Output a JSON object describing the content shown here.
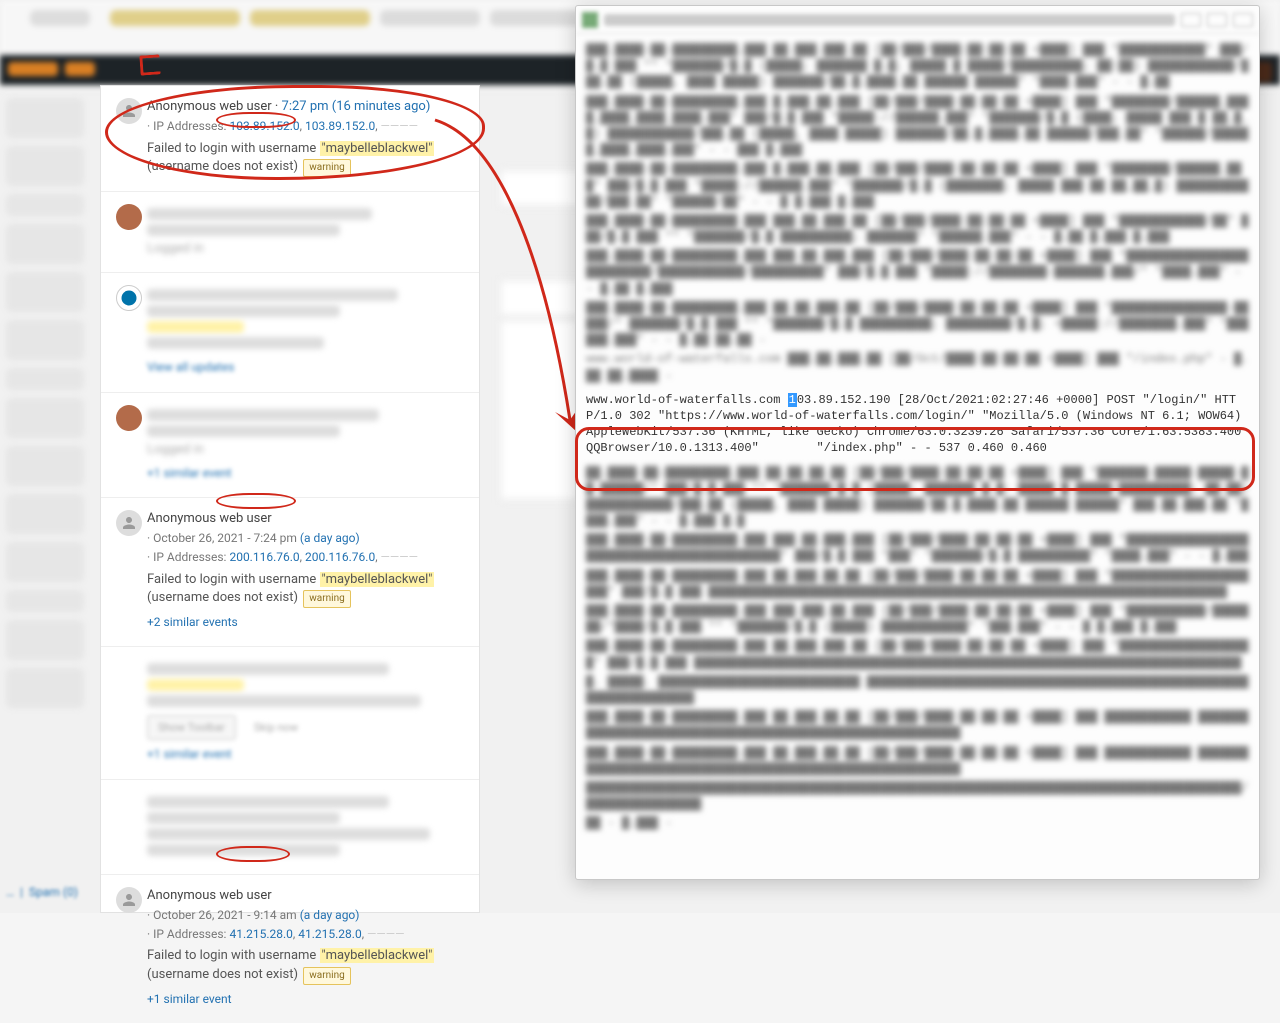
{
  "feed": [
    {
      "user": "Anonymous web user",
      "time": "7:27 pm (16 minutes ago)",
      "ip_label": "IP Addresses:",
      "ip1": "103.89.152.0",
      "ip2": "103.89.152.0",
      "msg_pre": "Failed to login with username ",
      "hl": "\"maybelleblackwel\"",
      "msg_post": " (username does not exist) ",
      "badge": "warning"
    },
    {
      "user": "Anonymous web user",
      "time_pre": "October 26, 2021 - 7:24 pm ",
      "time": "(a day ago)",
      "ip_label": "IP Addresses:",
      "ip1": "200.116.76.0",
      "ip2": "200.116.76.0",
      "msg_pre": "Failed to login with username ",
      "hl": "\"maybelleblackwel\"",
      "msg_post": " (username does not exist) ",
      "badge": "warning",
      "link": "+2 similar events"
    },
    {
      "user": "Anonymous web user",
      "time_pre": "October 26, 2021 - 9:14 am ",
      "time": "(a day ago)",
      "ip_label": "IP Addresses:",
      "ip1": "41.215.28.0",
      "ip2": "41.215.28.0",
      "msg_pre": "Failed to login with username ",
      "hl": "\"maybelleblackwel\"",
      "msg_post": " (username does not exist) ",
      "badge": "warning",
      "link": "+1 similar event"
    }
  ],
  "logline": "www.world-of-waterfalls.com 103.89.152.190 [28/Oct/2021:02:27:46 +0000] POST \"/login/\" HTTP/1.0 302 \"https://www.world-of-waterfalls.com/login/\" \"Mozilla/5.0 (Windows NT 6.1; WOW64) AppleWebKit/537.36 (KHTML, like Gecko) Chrome/63.0.3239.26 Safari/537.36 Core/1.63.5383.400 QQBrowser/10.0.1313.400\"        \"/index.php\" - - 537 0.460 0.460",
  "log_sel": "1",
  "bottom": {
    "spam": "Spam (0)"
  },
  "blur": {
    "logged_in": "Logged in",
    "view_updates": "View all updates",
    "similar1": "+1 similar event",
    "show_toolbar": "Show Toolbar",
    "skip_now": "Skip now"
  }
}
